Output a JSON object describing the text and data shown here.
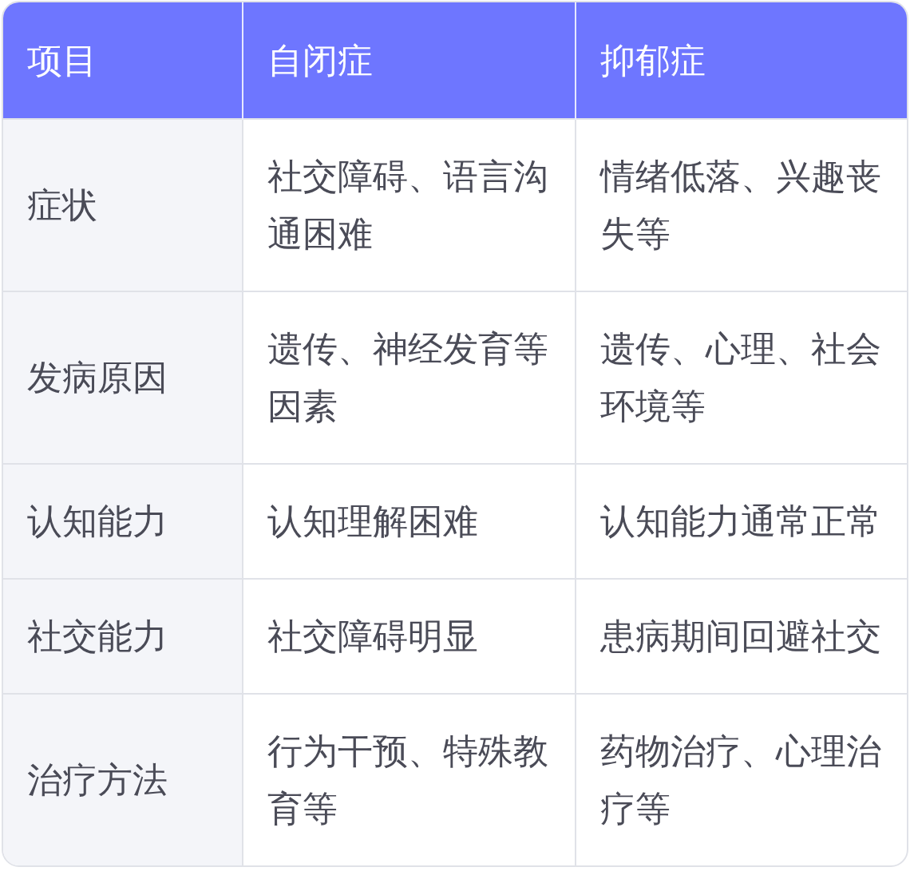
{
  "table": {
    "columns": [
      "项目",
      "自闭症",
      "抑郁症"
    ],
    "rows": [
      [
        "症状",
        "社交障碍、语言沟通困难",
        "情绪低落、兴趣丧失等"
      ],
      [
        "发病原因",
        "遗传、神经发育等因素",
        "遗传、心理、社会环境等"
      ],
      [
        "认知能力",
        "认知理解困难",
        "认知能力通常正常"
      ],
      [
        "社交能力",
        "社交障碍明显",
        "患病期间回避社交"
      ],
      [
        "治疗方法",
        "行为干预、特殊教育等",
        "药物治疗、心理治疗等"
      ]
    ]
  }
}
